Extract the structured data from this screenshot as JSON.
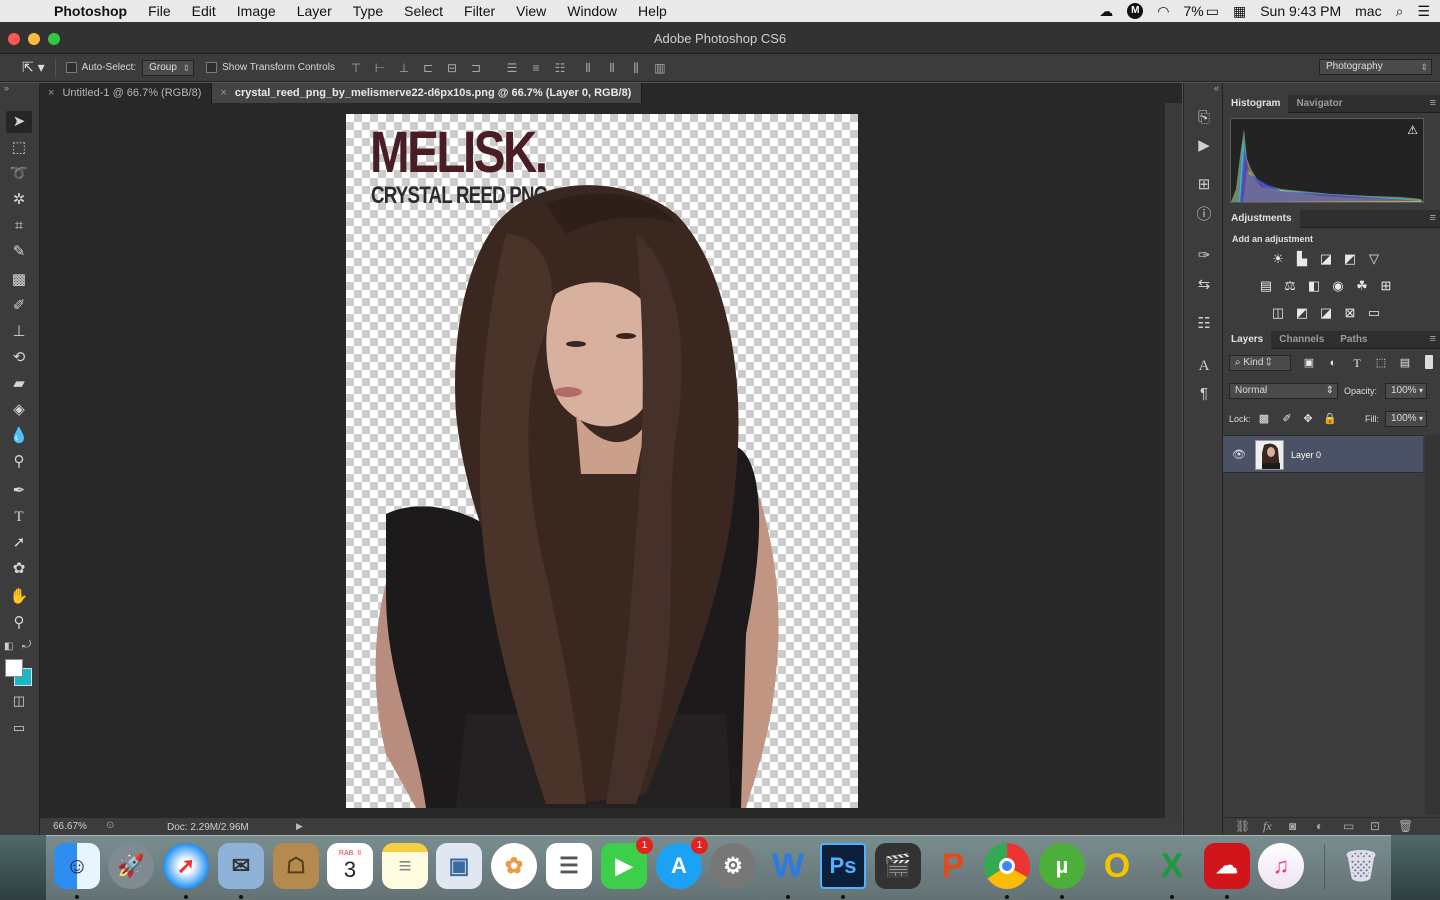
{
  "menubar": {
    "apple": "",
    "app_name": "Photoshop",
    "items": [
      "File",
      "Edit",
      "Image",
      "Layer",
      "Type",
      "Select",
      "Filter",
      "View",
      "Window",
      "Help"
    ],
    "status": {
      "battery": "7%",
      "clock": "Sun 9:43 PM",
      "user": "mac"
    }
  },
  "window": {
    "title": "Adobe Photoshop CS6"
  },
  "options": {
    "auto_select_label": "Auto-Select:",
    "auto_select_value": "Group",
    "transform_label": "Show Transform Controls",
    "workspace": "Photography"
  },
  "tabs": [
    {
      "label": "Untitled-1 @ 66.7% (RGB/8)"
    },
    {
      "label": "crystal_reed_png_by_melismerve22-d6px10s.png @ 66.7% (Layer 0, RGB/8)"
    }
  ],
  "canvas": {
    "watermark_title": "MELISK.",
    "watermark_subtitle": "CRYSTAL REED PNG"
  },
  "statusbar": {
    "zoom": "66.67%",
    "doc": "Doc: 2.29M/2.96M"
  },
  "panels": {
    "histogram": {
      "tabs": [
        "Histogram",
        "Navigator"
      ]
    },
    "adjustments": {
      "title": "Adjustments",
      "subtitle": "Add an adjustment"
    },
    "layers": {
      "tabs": [
        "Layers",
        "Channels",
        "Paths"
      ],
      "filter": "Kind",
      "blend_mode": "Normal",
      "opacity_label": "Opacity:",
      "opacity": "100%",
      "lock_label": "Lock:",
      "fill_label": "Fill:",
      "fill": "100%",
      "layer_name": "Layer 0"
    }
  },
  "dock": {
    "calendar_month": "RAB. II",
    "calendar_day": "3",
    "facetime_badge": "1",
    "appstore_badge": "1",
    "apps": [
      "finder-icon",
      "launchpad-icon",
      "safari-icon",
      "preview-icon",
      "contacts-icon",
      "calendar-icon",
      "notes-icon",
      "photo-booth-icon",
      "photos-icon",
      "reminders-icon",
      "facetime-icon",
      "app-store-icon",
      "system-preferences-icon",
      "word-icon",
      "photoshop-icon",
      "final-cut-icon",
      "powerpoint-icon",
      "chrome-icon",
      "utorrent-icon",
      "office-icon",
      "excel-icon",
      "creative-cloud-icon",
      "itunes-icon",
      "trash-icon"
    ]
  }
}
